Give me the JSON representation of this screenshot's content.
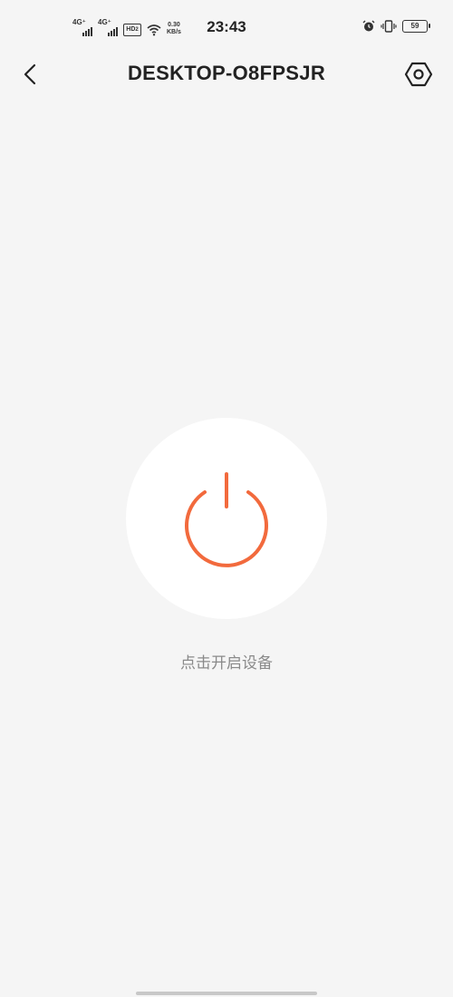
{
  "status_bar": {
    "signal1_label": "4G⁺",
    "signal2_label": "4G⁺",
    "hd_label": "HD",
    "hd_sub": "2",
    "net_speed_value": "0.30",
    "net_speed_unit": "KB/s",
    "time": "23:43",
    "battery_level": "59",
    "icons": [
      "signal-icon",
      "wifi-icon",
      "alarm-icon",
      "vibrate-icon",
      "battery-icon"
    ]
  },
  "header": {
    "title": "DESKTOP-O8FPSJR",
    "back_icon": "chevron-left-icon",
    "settings_icon": "hexagon-settings-icon"
  },
  "power": {
    "icon": "power-icon",
    "hint": "点击开启设备",
    "accent_color": "#f26a3d"
  }
}
